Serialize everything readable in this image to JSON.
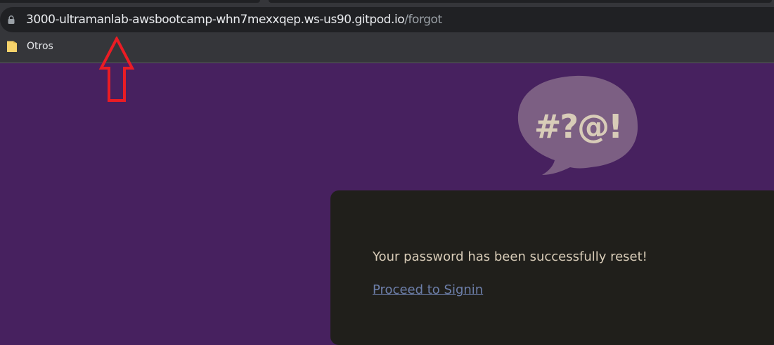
{
  "browser": {
    "url_host": "3000-ultramanlab-awsbootcamp-whn7mexxqep.ws-us90.gitpod.io",
    "url_path": "/forgot",
    "bookmarks": [
      {
        "label": "Otros",
        "icon": "folder-icon"
      }
    ]
  },
  "annotation": {
    "icon": "red-up-arrow",
    "color": "#ea1c24"
  },
  "logo": {
    "text": "#?@!",
    "bubble_color": "#7c5f83",
    "text_color": "#d8ccb8"
  },
  "card": {
    "message": "Your password has been successfully reset!",
    "link_label": "Proceed to Signin"
  },
  "colors": {
    "page_background": "#47215f",
    "card_background": "#201f1b",
    "link": "#6d7faa"
  }
}
